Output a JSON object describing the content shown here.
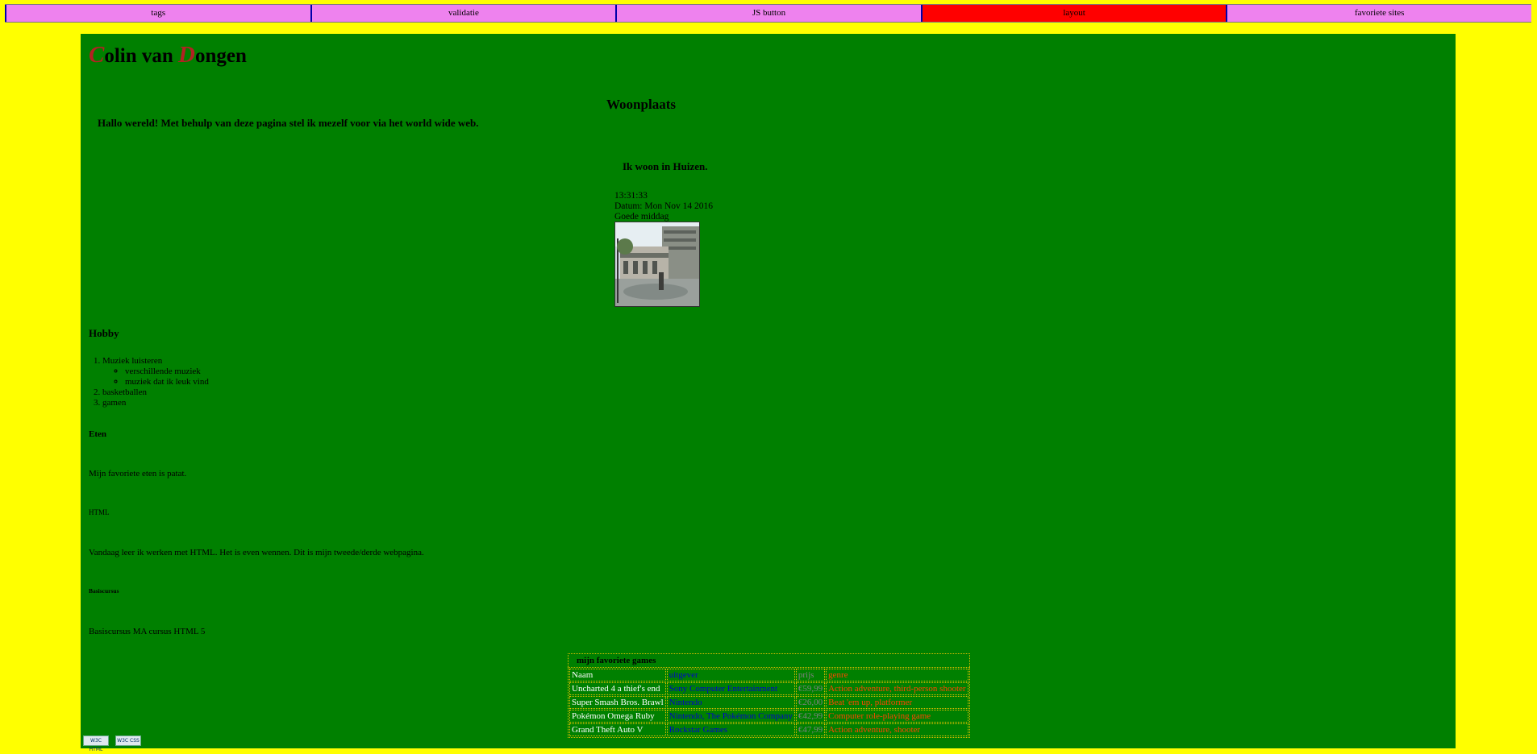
{
  "nav": {
    "items": [
      {
        "label": "tags"
      },
      {
        "label": "validatie"
      },
      {
        "label": "JS button"
      },
      {
        "label": "layout",
        "active": true
      },
      {
        "label": "favoriete sites"
      }
    ]
  },
  "header": {
    "initial1": "C",
    "rest1": "olin van ",
    "initial2": "D",
    "rest2": "ongen"
  },
  "intro": "Hallo wereld! Met behulp van deze pagina stel ik mezelf voor via het world wide web.",
  "woonplaats": {
    "title": "Woonplaats",
    "text": "Ik woon in Huizen.",
    "time": "13:31:33",
    "date": "Datum: Mon Nov 14 2016",
    "greeting": "Goede middag"
  },
  "hobby": {
    "title": "Hobby",
    "items": [
      {
        "label": "Muziek luisteren",
        "sub": [
          "verschillende muziek",
          "muziek dat ik leuk vind"
        ]
      },
      {
        "label": "basketballen"
      },
      {
        "label": "gamen"
      }
    ]
  },
  "eten": {
    "title": "Eten",
    "text": "Mijn favoriete eten is patat."
  },
  "html_section": {
    "title": "HTML",
    "text": "Vandaag leer ik werken met HTML. Het is even wennen. Dit is mijn tweede/derde webpagina."
  },
  "basis": {
    "title": "Basiscursus",
    "text": "Basiscursus MA cursus HTML 5"
  },
  "games": {
    "caption": "mijn favoriete games",
    "header": [
      "Naam",
      "uitgever",
      "prijs",
      "genre"
    ],
    "rows": [
      [
        "Uncharted 4 a thief's end",
        "Sony Computer Entertainment",
        "€59,99",
        "Action adventure, third-person shooter"
      ],
      [
        "Super Smash Bros. Brawl",
        "Nintendo",
        "€26,00",
        "Beat 'em up, platformer"
      ],
      [
        "Pokémon Omega Ruby",
        "Nintendo, The Pokémon Company",
        "€42,99",
        "Computer role-playing game"
      ],
      [
        "Grand Theft Auto V",
        "Rockstar Games",
        "€47,99",
        "Action adventure, shooter"
      ]
    ]
  },
  "badges": [
    "W3C HTML",
    "W3C CSS"
  ]
}
